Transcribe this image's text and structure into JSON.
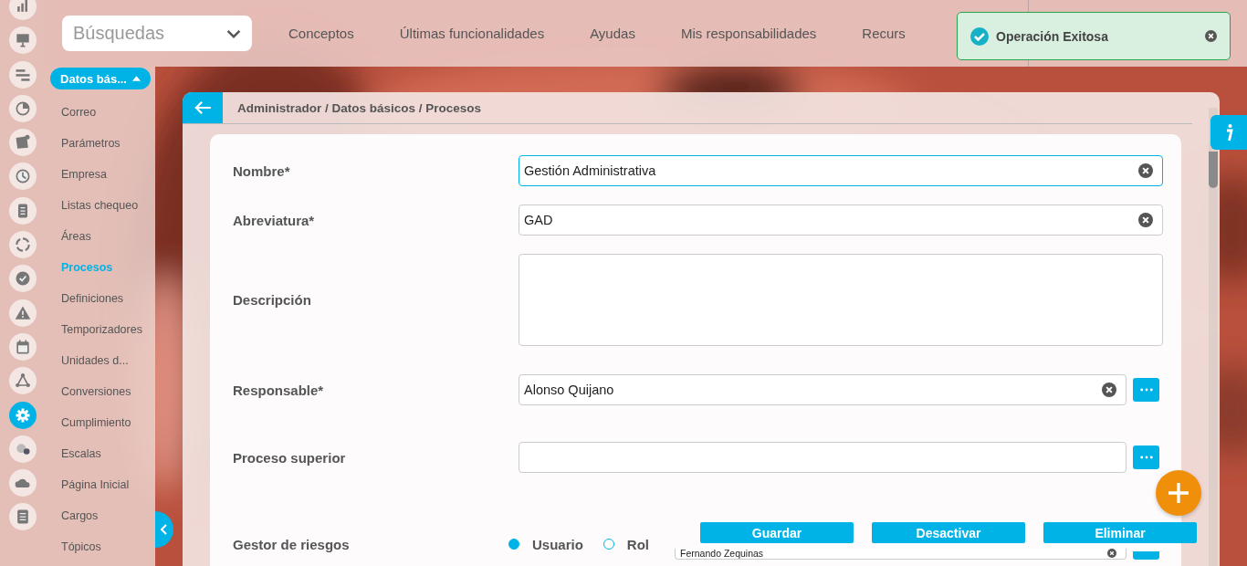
{
  "rail": [
    {
      "selected": false
    },
    {
      "selected": false
    },
    {
      "selected": false
    },
    {
      "selected": false
    },
    {
      "selected": false
    },
    {
      "selected": false
    },
    {
      "selected": false
    },
    {
      "selected": false
    },
    {
      "selected": false
    },
    {
      "selected": false
    },
    {
      "selected": false
    },
    {
      "selected": false
    },
    {
      "selected": true
    },
    {
      "selected": false
    },
    {
      "selected": false
    },
    {
      "selected": false
    }
  ],
  "search": {
    "placeholder": "Búsquedas"
  },
  "nav": [
    "Conceptos",
    "Últimas funcionalidades",
    "Ayudas",
    "Mis responsabilidades",
    "Recurs"
  ],
  "module_button": {
    "label": "Datos bás..."
  },
  "sidebar": {
    "items": [
      {
        "label": "Correo",
        "selected": false
      },
      {
        "label": "Parámetros",
        "selected": false
      },
      {
        "label": "Empresa",
        "selected": false
      },
      {
        "label": "Listas chequeo",
        "selected": false
      },
      {
        "label": "Áreas",
        "selected": false
      },
      {
        "label": "Procesos",
        "selected": true
      },
      {
        "label": "Definiciones",
        "selected": false
      },
      {
        "label": "Temporizadores",
        "selected": false
      },
      {
        "label": "Unidades d...",
        "selected": false
      },
      {
        "label": "Conversiones",
        "selected": false
      },
      {
        "label": "Cumplimiento",
        "selected": false
      },
      {
        "label": "Escalas",
        "selected": false
      },
      {
        "label": "Página Inicial",
        "selected": false
      },
      {
        "label": "Cargos",
        "selected": false
      },
      {
        "label": "Tópicos",
        "selected": false
      }
    ]
  },
  "breadcrumb": "Administrador / Datos básicos / Procesos",
  "form": [
    {
      "kind": "text",
      "label": "Nombre*",
      "value": "Gestión Administrativa",
      "focused": true
    },
    {
      "kind": "text",
      "label": "Abreviatura*",
      "value": "GAD",
      "focused": false
    },
    {
      "kind": "textarea",
      "label": "Descripción",
      "focused": false
    },
    {
      "kind": "lookup",
      "label": "Responsable*",
      "value": "Alonso Quijano",
      "focused": false
    },
    {
      "kind": "lookup",
      "label": "Proceso superior",
      "focused": false
    },
    {
      "kind": "radio-lookup",
      "label": "Gestor de riesgos",
      "options": [
        {
          "label": "Usuario",
          "selected": true
        },
        {
          "label": "Rol",
          "selected": false
        }
      ],
      "value": "Fernando Zequinas",
      "focused": false
    }
  ],
  "actions": [
    "Guardar",
    "Desactivar",
    "Eliminar"
  ],
  "toast": {
    "text": "Operación Exitosa"
  }
}
